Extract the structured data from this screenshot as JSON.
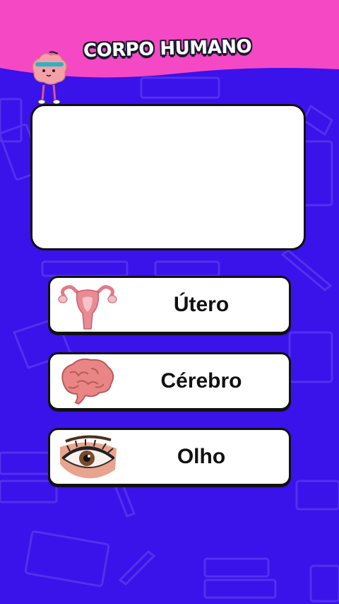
{
  "header": {
    "title": "CORPO HUMANO"
  },
  "options": [
    {
      "label": "Útero",
      "icon": "uterus-icon"
    },
    {
      "label": "Cérebro",
      "icon": "brain-icon"
    },
    {
      "label": "Olho",
      "icon": "eye-icon"
    }
  ],
  "colors": {
    "background": "#3a12ea",
    "header": "#f548c4",
    "card": "#ffffff",
    "outline": "#111111"
  }
}
